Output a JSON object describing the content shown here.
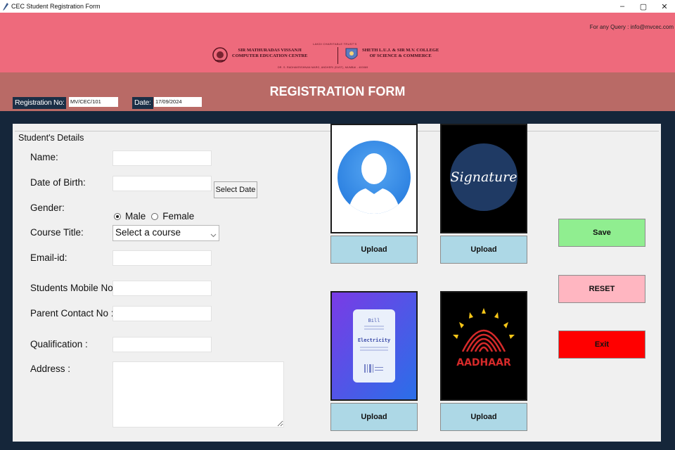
{
  "window": {
    "title": "CEC Student Registration Form",
    "controls": {
      "minimize": "–",
      "maximize": "▢",
      "close": "✕"
    }
  },
  "header": {
    "query": "For any Query : info@mvcec.com",
    "trust": "LAKDI CHARITABLE TRUST'S",
    "org1_line1": "SIR MATHURADAS VISSANJI",
    "org1_line2": "COMPUTER EDUCATION CENTRE",
    "org2_line1": "SHETH L.U.J. & SIR M.V. COLLEGE",
    "org2_line2": "OF SCIENCE & COMMERCE",
    "address": "DR. S. RADHAKRISHNAN MARG, ANDHERI (EAST), MUMBAI - 400069"
  },
  "form": {
    "title": "REGISTRATION FORM",
    "registration_label": "Registration No:",
    "registration_value": "MV/CEC/101",
    "date_label": "Date:",
    "date_value": "17/09/2024"
  },
  "details": {
    "legend": "Student's Details",
    "name_label": "Name:",
    "dob_label": "Date of Birth:",
    "select_date": "Select Date",
    "gender_label": "Gender:",
    "gender_options": [
      "Male",
      "Female"
    ],
    "course_label": "Course Title:",
    "course_placeholder": "Select a course",
    "email_label": "Email-id:",
    "mobile_label": "Students Mobile No:",
    "parent_label": "Parent Contact No :",
    "qualification_label": "Qualification :",
    "address_label": "Address :"
  },
  "uploads": {
    "upload_label": "Upload",
    "signature_text": "Signature",
    "bill_title": "Bill",
    "bill_text": "Electricity",
    "aadhaar_text": "AADHAAR"
  },
  "actions": {
    "save": "Save",
    "reset": "RESET",
    "exit": "Exit"
  },
  "colors": {
    "header_pink": "#ee6a7c",
    "subheader": "#b96a66",
    "background_navy": "#15263a",
    "upload_blue": "#add8e6",
    "save_green": "#90ee90",
    "reset_pink": "#ffb6c1",
    "exit_red": "#ff0000"
  },
  "icons": [
    "pen-icon",
    "minimize-icon",
    "maximize-icon",
    "close-icon",
    "college-emblem-icon",
    "chevron-down-icon",
    "user-avatar-icon",
    "signature-icon",
    "electricity-bill-icon",
    "aadhaar-icon"
  ]
}
